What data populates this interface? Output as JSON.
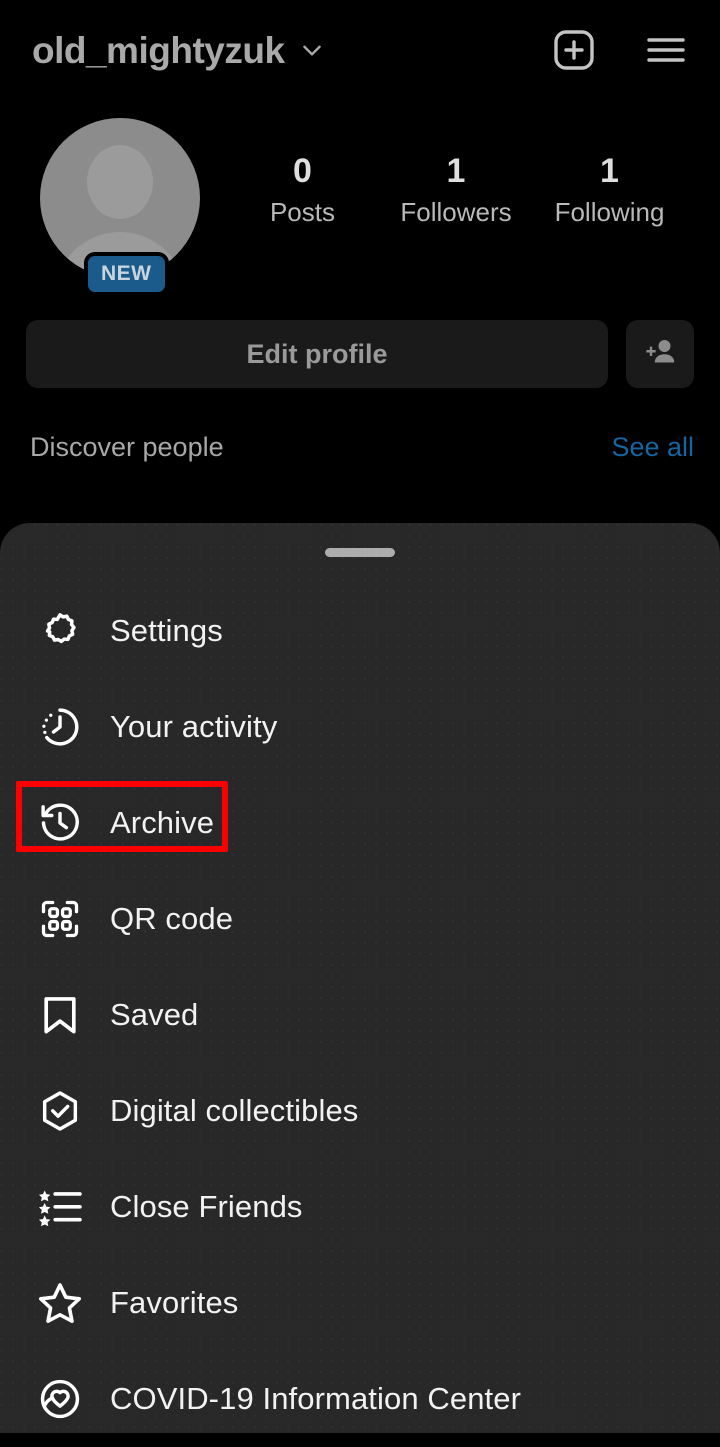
{
  "header": {
    "username": "old_mightyzuk",
    "chevron_icon": "chevron-down-icon",
    "create_icon": "plus-square-icon",
    "menu_icon": "hamburger-menu-icon"
  },
  "profile": {
    "avatar_icon": "default-avatar-icon",
    "new_badge": "NEW",
    "stats": [
      {
        "value": "0",
        "label": "Posts"
      },
      {
        "value": "1",
        "label": "Followers"
      },
      {
        "value": "1",
        "label": "Following"
      }
    ],
    "edit_profile_label": "Edit profile",
    "add_person_icon": "add-person-icon"
  },
  "discover": {
    "title": "Discover people",
    "see_all_label": "See all"
  },
  "sheet": {
    "handle": "drag-handle",
    "items": [
      {
        "label": "Settings",
        "icon": "gear-icon"
      },
      {
        "label": "Your activity",
        "icon": "clock-activity-icon"
      },
      {
        "label": "Archive",
        "icon": "archive-clock-back-icon"
      },
      {
        "label": "QR code",
        "icon": "qr-code-icon"
      },
      {
        "label": "Saved",
        "icon": "bookmark-icon"
      },
      {
        "label": "Digital collectibles",
        "icon": "hexagon-check-icon"
      },
      {
        "label": "Close Friends",
        "icon": "star-list-icon"
      },
      {
        "label": "Favorites",
        "icon": "star-icon"
      },
      {
        "label": "COVID-19 Information Center",
        "icon": "heart-circle-icon"
      }
    ]
  },
  "colors": {
    "background": "#000000",
    "sheet_background": "#282828",
    "accent_link": "#1565a0",
    "badge_blue": "#1a5b8c",
    "highlight_red": "#fc0000"
  }
}
